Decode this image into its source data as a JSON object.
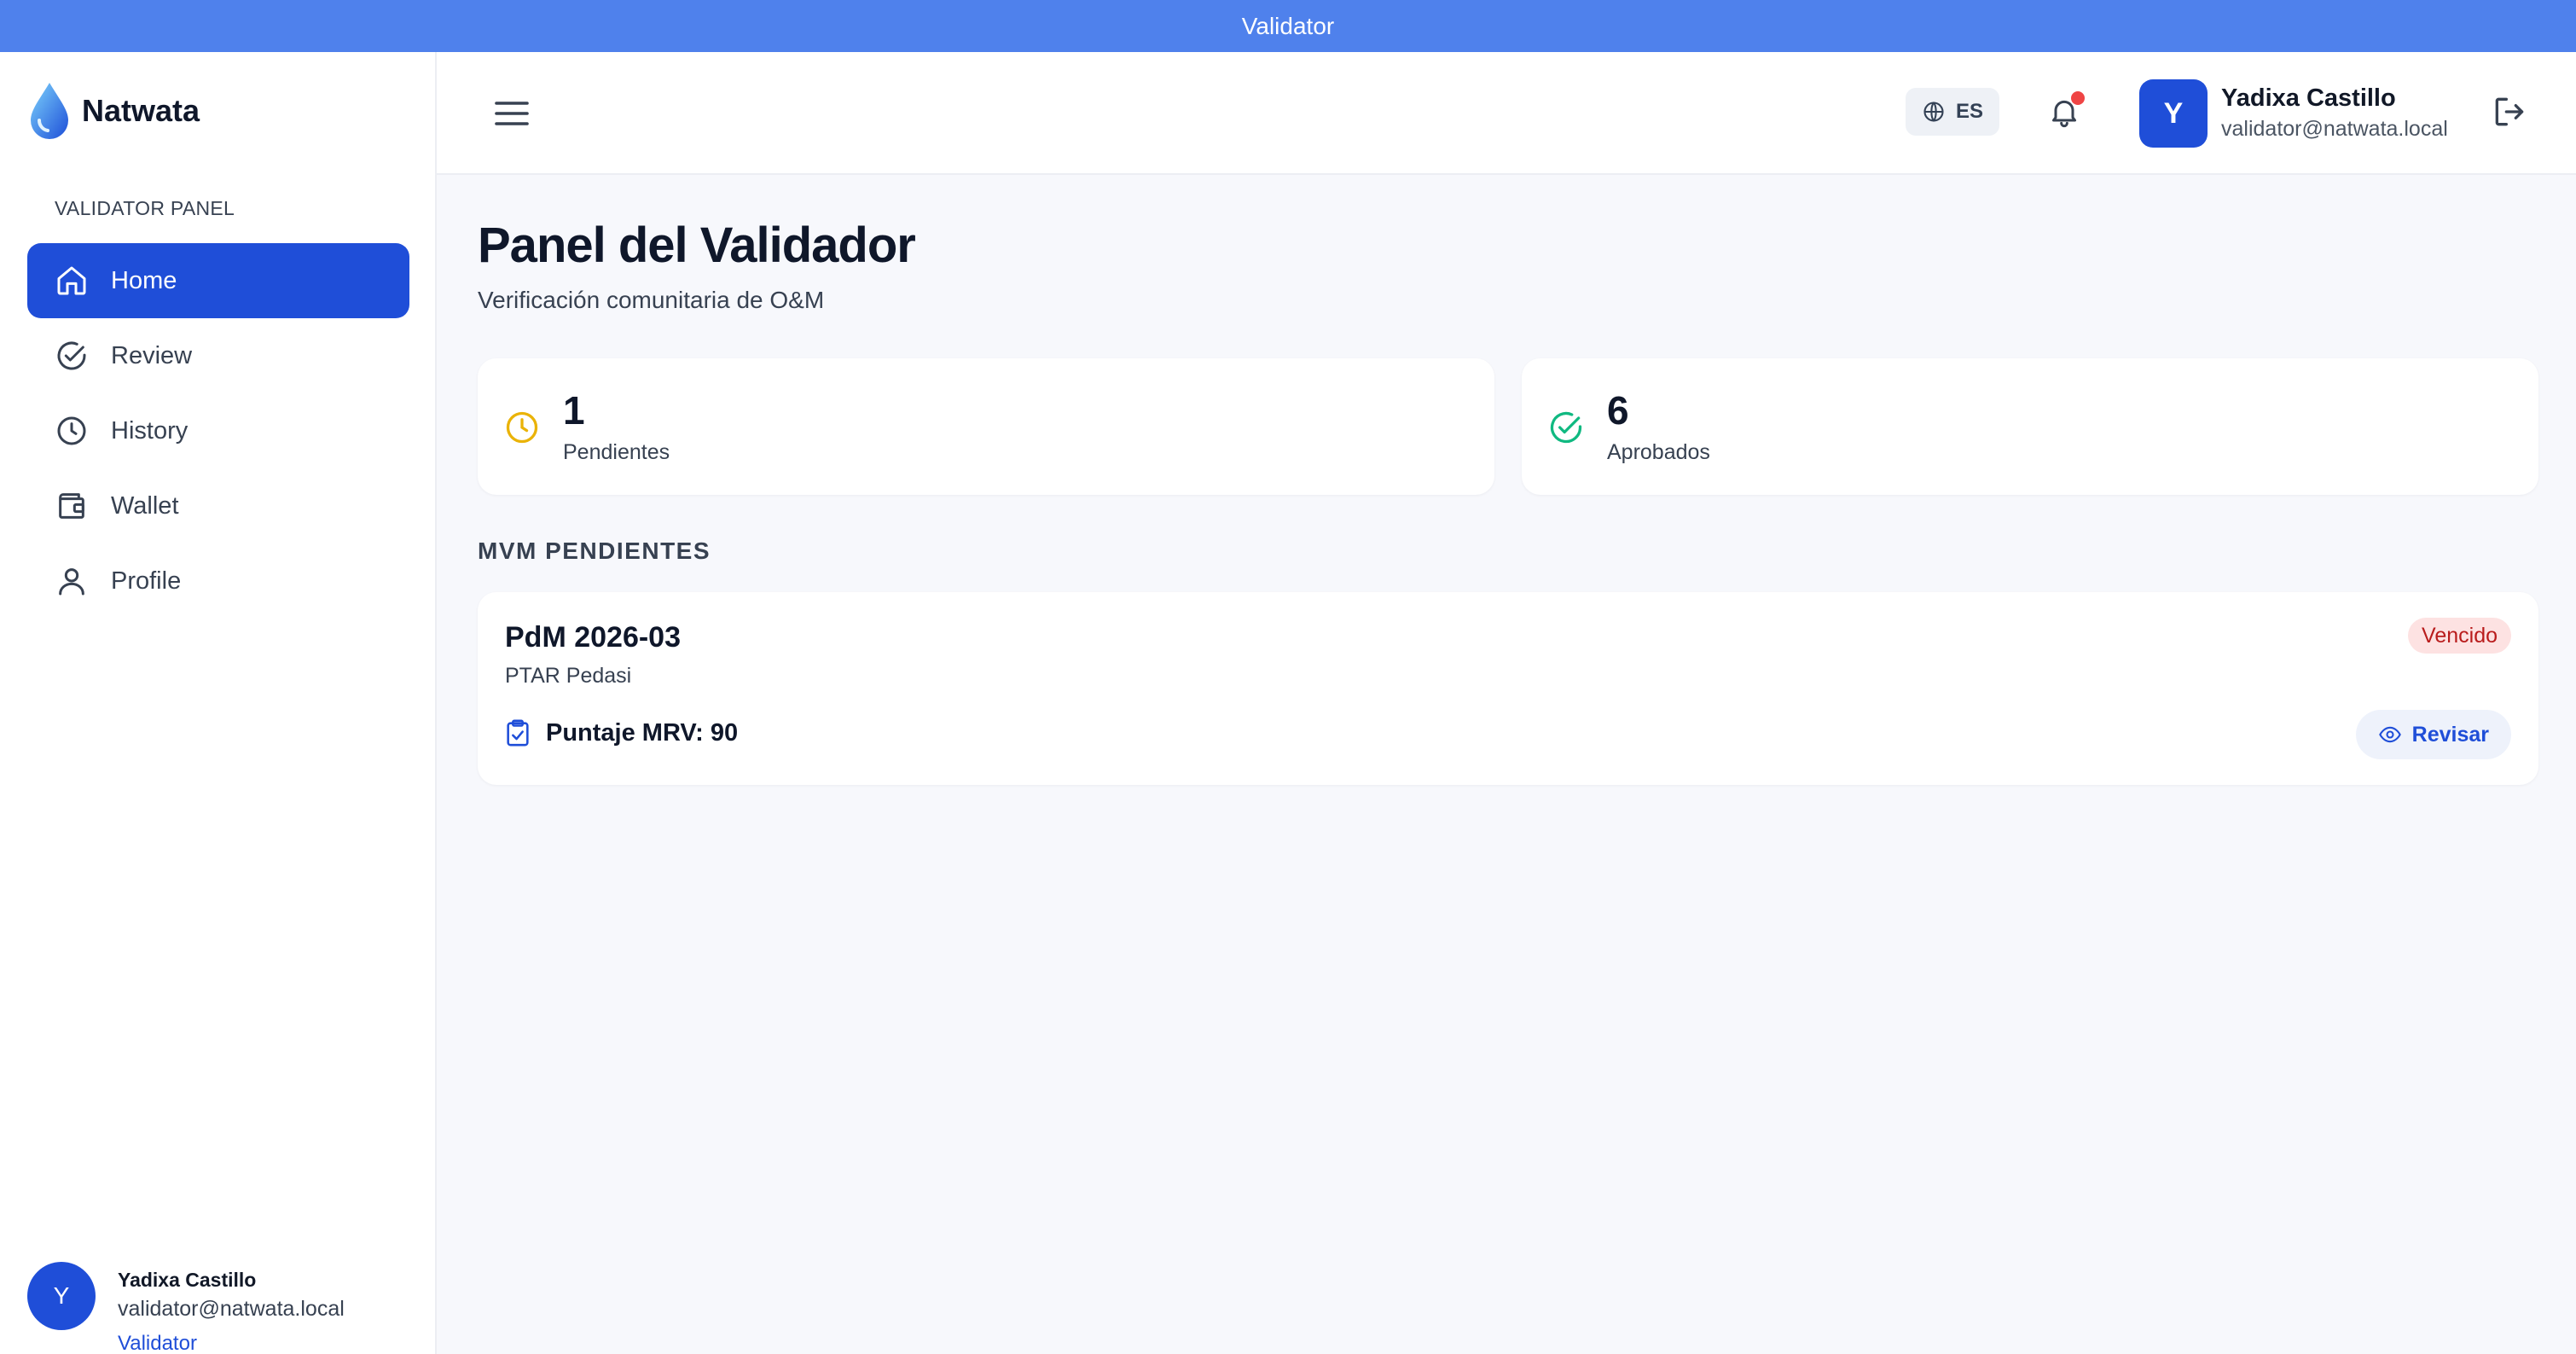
{
  "window": {
    "title": "Validator"
  },
  "brand": {
    "name": "Natwata"
  },
  "sidebar": {
    "heading": "VALIDATOR PANEL",
    "items": [
      {
        "label": "Home",
        "icon": "home-icon",
        "active": true
      },
      {
        "label": "Review",
        "icon": "check-circle-icon",
        "active": false
      },
      {
        "label": "History",
        "icon": "clock-icon",
        "active": false
      },
      {
        "label": "Wallet",
        "icon": "wallet-icon",
        "active": false
      },
      {
        "label": "Profile",
        "icon": "user-icon",
        "active": false
      }
    ],
    "user": {
      "initial": "Y",
      "name": "Yadixa Castillo",
      "email": "validator@natwata.local",
      "role": "Validator"
    }
  },
  "header": {
    "language": "ES",
    "has_notifications": true,
    "user": {
      "initial": "Y",
      "name": "Yadixa Castillo",
      "email": "validator@natwata.local"
    }
  },
  "main": {
    "title": "Panel del Validador",
    "subtitle": "Verificación comunitaria de O&M",
    "stats": [
      {
        "value": "1",
        "label": "Pendientes",
        "icon": "clock-icon",
        "color": "#eab308"
      },
      {
        "value": "6",
        "label": "Aprobados",
        "icon": "check-circle-icon",
        "color": "#10b981"
      }
    ],
    "section_title": "MVM PENDIENTES",
    "pending": [
      {
        "title": "PdM 2026-03",
        "site": "PTAR Pedasi",
        "status": "Vencido",
        "score_text": "Puntaje MRV: 90",
        "action": "Revisar"
      }
    ]
  },
  "colors": {
    "primary": "#1f4ed8",
    "titlebar": "#4f81ec",
    "danger": "#ef4444"
  }
}
